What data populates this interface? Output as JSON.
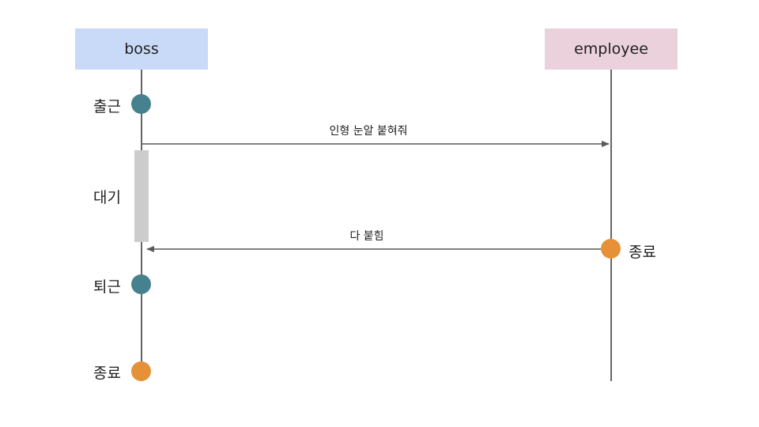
{
  "actors": {
    "boss": {
      "label": "boss",
      "fill": "#c9daf8"
    },
    "employee": {
      "label": "employee",
      "fill": "#ead1dc"
    }
  },
  "colors": {
    "teal": "#45818e",
    "orange": "#e69138",
    "line": "#595959",
    "activation": "#cccccc"
  },
  "events": {
    "boss_start": "출근",
    "boss_wait": "대기",
    "boss_leave": "퇴근",
    "boss_end": "종료",
    "employee_end": "종료"
  },
  "messages": {
    "request": "인형 눈알 붙혀줘",
    "reply": "다 붙힘"
  }
}
